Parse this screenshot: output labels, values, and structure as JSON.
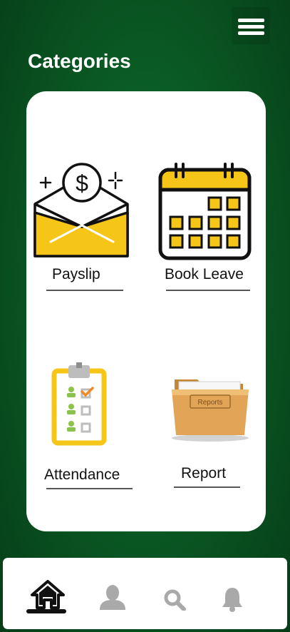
{
  "header": {
    "title": "Categories"
  },
  "categories": [
    {
      "label": "Payslip",
      "icon": "payslip-envelope-icon"
    },
    {
      "label": "Book Leave",
      "icon": "calendar-icon"
    },
    {
      "label": "Attendance",
      "icon": "attendance-clipboard-icon"
    },
    {
      "label": "Report",
      "icon": "reports-folder-icon"
    }
  ],
  "report_folder_label": "Reports",
  "payslip_symbol": "$",
  "bottom_nav": [
    {
      "icon": "home-icon",
      "active": true
    },
    {
      "icon": "profile-icon",
      "active": false
    },
    {
      "icon": "search-icon",
      "active": false
    },
    {
      "icon": "bell-icon",
      "active": false
    }
  ],
  "colors": {
    "accent_yellow": "#f5c518",
    "brand_green": "#0a5a24",
    "inactive_icon": "#a9a9a9"
  }
}
